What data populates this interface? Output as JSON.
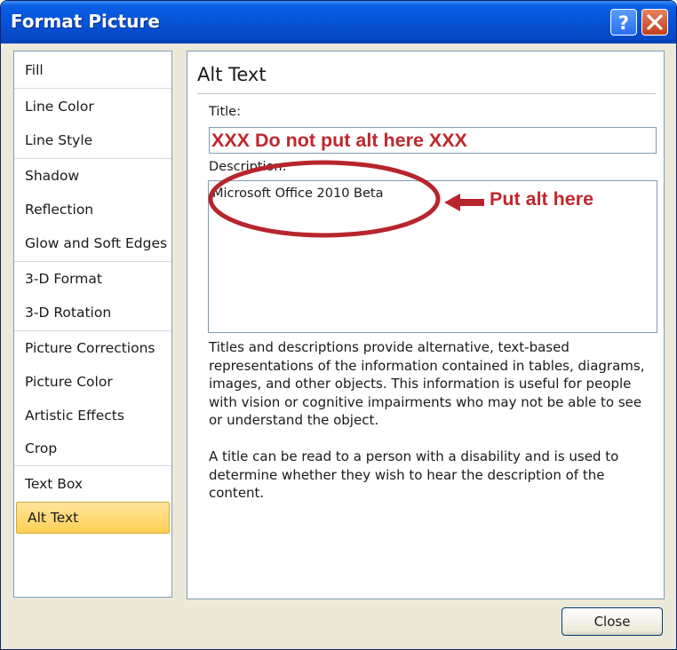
{
  "window": {
    "title": "Format Picture",
    "help_glyph": "?",
    "close_glyph": "✕"
  },
  "sidebar": {
    "items": [
      {
        "label": "Fill"
      },
      {
        "label": "Line Color"
      },
      {
        "label": "Line Style"
      },
      {
        "label": "Shadow"
      },
      {
        "label": "Reflection"
      },
      {
        "label": "Glow and Soft Edges"
      },
      {
        "label": "3-D Format"
      },
      {
        "label": "3-D Rotation"
      },
      {
        "label": "Picture Corrections"
      },
      {
        "label": "Picture Color"
      },
      {
        "label": "Artistic Effects"
      },
      {
        "label": "Crop"
      },
      {
        "label": "Text Box"
      },
      {
        "label": "Alt Text",
        "selected": true
      }
    ]
  },
  "alt_text": {
    "heading": "Alt Text",
    "title_label": "Title:",
    "title_value": "XXX Do not put alt here XXX",
    "description_label": "Description:",
    "description_value": "Microsoft Office 2010 Beta",
    "annotation": "Put alt here",
    "help_paragraph_1": "Titles and descriptions provide alternative, text-based representations of the information contained in tables, diagrams, images, and other objects. This information is useful for people with vision or cognitive impairments who may not be able to see or understand the object.",
    "help_paragraph_2": "A title can be read to a person with a disability and is used to determine whether they wish to hear the description of the content."
  },
  "footer": {
    "close_label": "Close"
  },
  "colors": {
    "titlebar_blue": "#0753d6",
    "annotation_red": "#c0272d",
    "selected_item": "#ffd056"
  }
}
